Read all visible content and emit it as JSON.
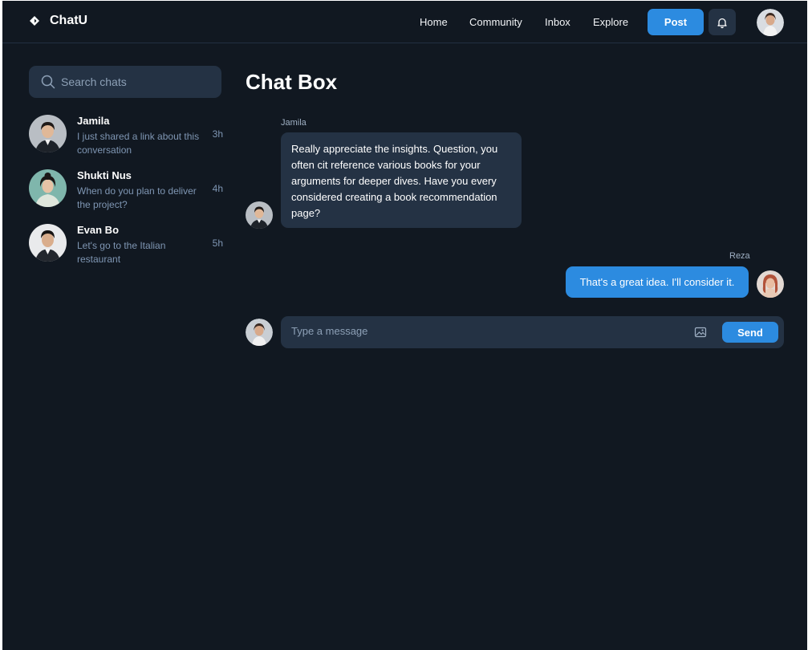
{
  "app": {
    "name": "ChatU"
  },
  "nav": {
    "items": [
      "Home",
      "Community",
      "Inbox",
      "Explore"
    ],
    "post_label": "Post"
  },
  "search": {
    "placeholder": "Search chats"
  },
  "chats": [
    {
      "name": "Jamila",
      "preview": "I just shared a link about this conversation",
      "time": "3h"
    },
    {
      "name": "Shukti Nus",
      "preview": "When do you plan to deliver the project?",
      "time": "4h"
    },
    {
      "name": "Evan Bo",
      "preview": "Let's go to the Italian restaurant",
      "time": "5h"
    }
  ],
  "main": {
    "title": "Chat Box",
    "messages": [
      {
        "sender": "Jamila",
        "text": "Really appreciate the insights. Question, you often cit reference various books for your arguments for deeper dives. Have you every considered creating a book recommendation page?"
      },
      {
        "sender": "Reza",
        "text": "That's a great idea. I'll consider it."
      }
    ],
    "composer": {
      "placeholder": "Type a message",
      "send_label": "Send"
    }
  },
  "colors": {
    "background": "#111821",
    "surface": "#243244",
    "accent": "#2c8be0",
    "muted_text": "#7f96b3"
  }
}
